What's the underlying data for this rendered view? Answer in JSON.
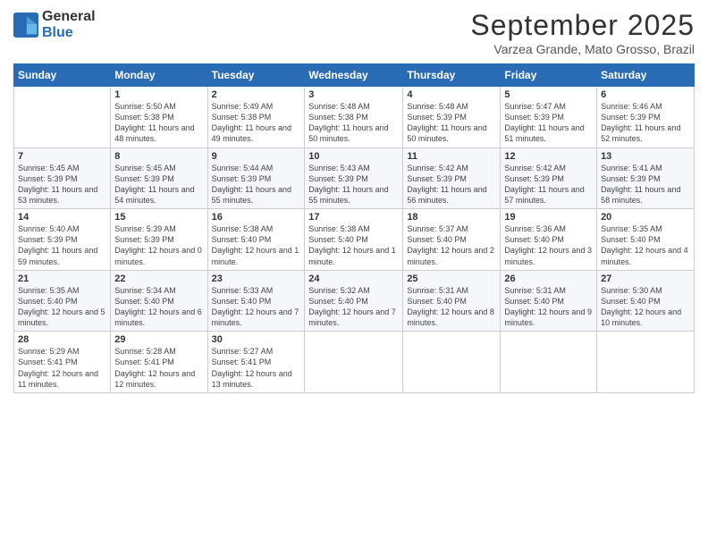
{
  "logo": {
    "general": "General",
    "blue": "Blue"
  },
  "title": "September 2025",
  "location": "Varzea Grande, Mato Grosso, Brazil",
  "headers": [
    "Sunday",
    "Monday",
    "Tuesday",
    "Wednesday",
    "Thursday",
    "Friday",
    "Saturday"
  ],
  "weeks": [
    [
      {
        "day": "",
        "sunrise": "",
        "sunset": "",
        "daylight": ""
      },
      {
        "day": "1",
        "sunrise": "Sunrise: 5:50 AM",
        "sunset": "Sunset: 5:38 PM",
        "daylight": "Daylight: 11 hours and 48 minutes."
      },
      {
        "day": "2",
        "sunrise": "Sunrise: 5:49 AM",
        "sunset": "Sunset: 5:38 PM",
        "daylight": "Daylight: 11 hours and 49 minutes."
      },
      {
        "day": "3",
        "sunrise": "Sunrise: 5:48 AM",
        "sunset": "Sunset: 5:38 PM",
        "daylight": "Daylight: 11 hours and 50 minutes."
      },
      {
        "day": "4",
        "sunrise": "Sunrise: 5:48 AM",
        "sunset": "Sunset: 5:39 PM",
        "daylight": "Daylight: 11 hours and 50 minutes."
      },
      {
        "day": "5",
        "sunrise": "Sunrise: 5:47 AM",
        "sunset": "Sunset: 5:39 PM",
        "daylight": "Daylight: 11 hours and 51 minutes."
      },
      {
        "day": "6",
        "sunrise": "Sunrise: 5:46 AM",
        "sunset": "Sunset: 5:39 PM",
        "daylight": "Daylight: 11 hours and 52 minutes."
      }
    ],
    [
      {
        "day": "7",
        "sunrise": "Sunrise: 5:45 AM",
        "sunset": "Sunset: 5:39 PM",
        "daylight": "Daylight: 11 hours and 53 minutes."
      },
      {
        "day": "8",
        "sunrise": "Sunrise: 5:45 AM",
        "sunset": "Sunset: 5:39 PM",
        "daylight": "Daylight: 11 hours and 54 minutes."
      },
      {
        "day": "9",
        "sunrise": "Sunrise: 5:44 AM",
        "sunset": "Sunset: 5:39 PM",
        "daylight": "Daylight: 11 hours and 55 minutes."
      },
      {
        "day": "10",
        "sunrise": "Sunrise: 5:43 AM",
        "sunset": "Sunset: 5:39 PM",
        "daylight": "Daylight: 11 hours and 55 minutes."
      },
      {
        "day": "11",
        "sunrise": "Sunrise: 5:42 AM",
        "sunset": "Sunset: 5:39 PM",
        "daylight": "Daylight: 11 hours and 56 minutes."
      },
      {
        "day": "12",
        "sunrise": "Sunrise: 5:42 AM",
        "sunset": "Sunset: 5:39 PM",
        "daylight": "Daylight: 11 hours and 57 minutes."
      },
      {
        "day": "13",
        "sunrise": "Sunrise: 5:41 AM",
        "sunset": "Sunset: 5:39 PM",
        "daylight": "Daylight: 11 hours and 58 minutes."
      }
    ],
    [
      {
        "day": "14",
        "sunrise": "Sunrise: 5:40 AM",
        "sunset": "Sunset: 5:39 PM",
        "daylight": "Daylight: 11 hours and 59 minutes."
      },
      {
        "day": "15",
        "sunrise": "Sunrise: 5:39 AM",
        "sunset": "Sunset: 5:39 PM",
        "daylight": "Daylight: 12 hours and 0 minutes."
      },
      {
        "day": "16",
        "sunrise": "Sunrise: 5:38 AM",
        "sunset": "Sunset: 5:40 PM",
        "daylight": "Daylight: 12 hours and 1 minute."
      },
      {
        "day": "17",
        "sunrise": "Sunrise: 5:38 AM",
        "sunset": "Sunset: 5:40 PM",
        "daylight": "Daylight: 12 hours and 1 minute."
      },
      {
        "day": "18",
        "sunrise": "Sunrise: 5:37 AM",
        "sunset": "Sunset: 5:40 PM",
        "daylight": "Daylight: 12 hours and 2 minutes."
      },
      {
        "day": "19",
        "sunrise": "Sunrise: 5:36 AM",
        "sunset": "Sunset: 5:40 PM",
        "daylight": "Daylight: 12 hours and 3 minutes."
      },
      {
        "day": "20",
        "sunrise": "Sunrise: 5:35 AM",
        "sunset": "Sunset: 5:40 PM",
        "daylight": "Daylight: 12 hours and 4 minutes."
      }
    ],
    [
      {
        "day": "21",
        "sunrise": "Sunrise: 5:35 AM",
        "sunset": "Sunset: 5:40 PM",
        "daylight": "Daylight: 12 hours and 5 minutes."
      },
      {
        "day": "22",
        "sunrise": "Sunrise: 5:34 AM",
        "sunset": "Sunset: 5:40 PM",
        "daylight": "Daylight: 12 hours and 6 minutes."
      },
      {
        "day": "23",
        "sunrise": "Sunrise: 5:33 AM",
        "sunset": "Sunset: 5:40 PM",
        "daylight": "Daylight: 12 hours and 7 minutes."
      },
      {
        "day": "24",
        "sunrise": "Sunrise: 5:32 AM",
        "sunset": "Sunset: 5:40 PM",
        "daylight": "Daylight: 12 hours and 7 minutes."
      },
      {
        "day": "25",
        "sunrise": "Sunrise: 5:31 AM",
        "sunset": "Sunset: 5:40 PM",
        "daylight": "Daylight: 12 hours and 8 minutes."
      },
      {
        "day": "26",
        "sunrise": "Sunrise: 5:31 AM",
        "sunset": "Sunset: 5:40 PM",
        "daylight": "Daylight: 12 hours and 9 minutes."
      },
      {
        "day": "27",
        "sunrise": "Sunrise: 5:30 AM",
        "sunset": "Sunset: 5:40 PM",
        "daylight": "Daylight: 12 hours and 10 minutes."
      }
    ],
    [
      {
        "day": "28",
        "sunrise": "Sunrise: 5:29 AM",
        "sunset": "Sunset: 5:41 PM",
        "daylight": "Daylight: 12 hours and 11 minutes."
      },
      {
        "day": "29",
        "sunrise": "Sunrise: 5:28 AM",
        "sunset": "Sunset: 5:41 PM",
        "daylight": "Daylight: 12 hours and 12 minutes."
      },
      {
        "day": "30",
        "sunrise": "Sunrise: 5:27 AM",
        "sunset": "Sunset: 5:41 PM",
        "daylight": "Daylight: 12 hours and 13 minutes."
      },
      {
        "day": "",
        "sunrise": "",
        "sunset": "",
        "daylight": ""
      },
      {
        "day": "",
        "sunrise": "",
        "sunset": "",
        "daylight": ""
      },
      {
        "day": "",
        "sunrise": "",
        "sunset": "",
        "daylight": ""
      },
      {
        "day": "",
        "sunrise": "",
        "sunset": "",
        "daylight": ""
      }
    ]
  ]
}
